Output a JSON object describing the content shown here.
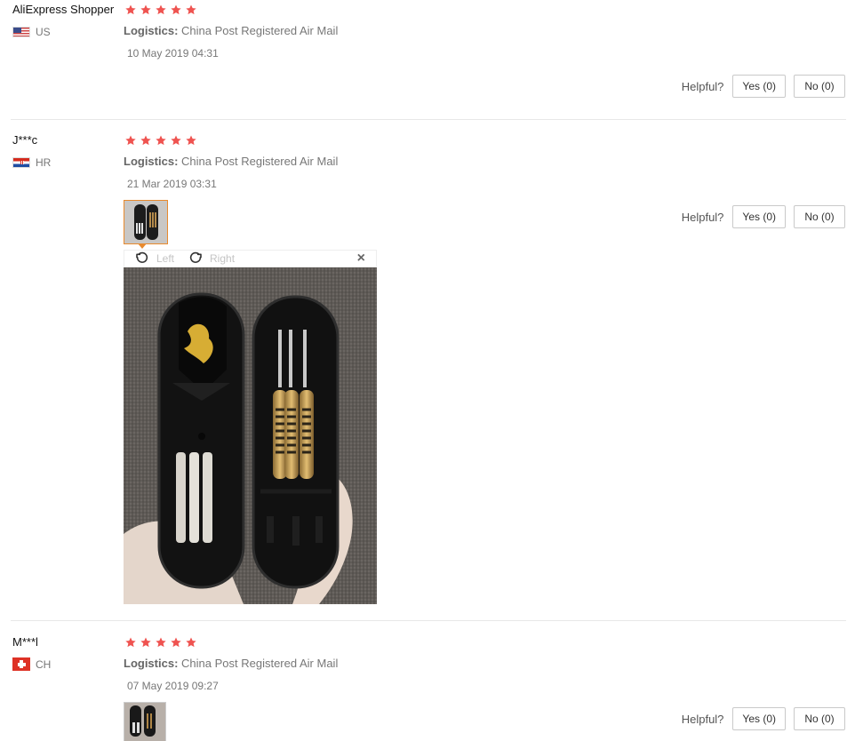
{
  "reviews": [
    {
      "user": "AliExpress Shopper",
      "country": "US",
      "logistics_label": "Logistics:",
      "logistics_value": "China Post Registered Air Mail",
      "date": "10 May 2019 04:31",
      "helpful_label": "Helpful?",
      "yes_label": "Yes (0)",
      "no_label": "No (0)",
      "rating": 5
    },
    {
      "user": "J***c",
      "country": "HR",
      "logistics_label": "Logistics:",
      "logistics_value": "China Post Registered Air Mail",
      "date": "21 Mar 2019 03:31",
      "helpful_label": "Helpful?",
      "yes_label": "Yes (0)",
      "no_label": "No (0)",
      "rating": 5,
      "preview_toolbar": {
        "left_label": "Left",
        "right_label": "Right"
      }
    },
    {
      "user": "M***l",
      "country": "CH",
      "logistics_label": "Logistics:",
      "logistics_value": "China Post Registered Air Mail",
      "date": "07 May 2019 09:27",
      "helpful_label": "Helpful?",
      "yes_label": "Yes (0)",
      "no_label": "No (0)",
      "rating": 5
    }
  ],
  "icons": {
    "rotate_left": "rotate-left-icon",
    "rotate_right": "rotate-right-icon",
    "close": "close-icon",
    "star": "star-icon"
  },
  "colors": {
    "star": "#ef5350",
    "thumb_active": "#e88a2e",
    "divider": "#e8e8e8"
  }
}
